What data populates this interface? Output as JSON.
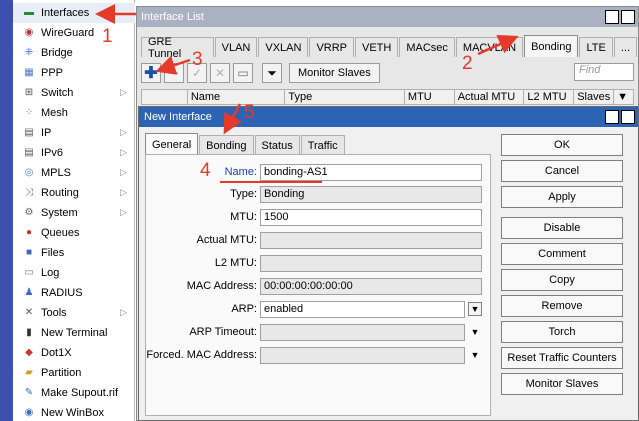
{
  "sidebar": {
    "items": [
      {
        "label": "Interfaces",
        "icon": "interfaces-icon",
        "glyph": "▬",
        "color": "#2a8a3a",
        "chev": false
      },
      {
        "label": "WireGuard",
        "icon": "wireguard-icon",
        "glyph": "◉",
        "color": "#b8323a",
        "chev": false
      },
      {
        "label": "Bridge",
        "icon": "bridge-icon",
        "glyph": "⁜",
        "color": "#2f6bbf",
        "chev": false
      },
      {
        "label": "PPP",
        "icon": "ppp-icon",
        "glyph": "▦",
        "color": "#4a7ac8",
        "chev": false
      },
      {
        "label": "Switch",
        "icon": "switch-icon",
        "glyph": "⊞",
        "color": "#555555",
        "chev": true
      },
      {
        "label": "Mesh",
        "icon": "mesh-icon",
        "glyph": "⁘",
        "color": "#3a6bbf",
        "chev": false
      },
      {
        "label": "IP",
        "icon": "ip-icon",
        "glyph": "▤",
        "color": "#555555",
        "chev": true
      },
      {
        "label": "IPv6",
        "icon": "ipv6-icon",
        "glyph": "▤",
        "color": "#555555",
        "chev": true
      },
      {
        "label": "MPLS",
        "icon": "mpls-icon",
        "glyph": "◎",
        "color": "#4a7ac8",
        "chev": true
      },
      {
        "label": "Routing",
        "icon": "routing-icon",
        "glyph": "⤨",
        "color": "#3a8a4a",
        "chev": true
      },
      {
        "label": "System",
        "icon": "system-icon",
        "glyph": "⚙",
        "color": "#6a6a6a",
        "chev": true
      },
      {
        "label": "Queues",
        "icon": "queues-icon",
        "glyph": "●",
        "color": "#c0392b",
        "chev": false
      },
      {
        "label": "Files",
        "icon": "files-icon",
        "glyph": "■",
        "color": "#3a6bbf",
        "chev": false
      },
      {
        "label": "Log",
        "icon": "log-icon",
        "glyph": "▭",
        "color": "#777777",
        "chev": false
      },
      {
        "label": "RADIUS",
        "icon": "radius-icon",
        "glyph": "♟",
        "color": "#3a6bbf",
        "chev": false
      },
      {
        "label": "Tools",
        "icon": "tools-icon",
        "glyph": "✕",
        "color": "#555555",
        "chev": true
      },
      {
        "label": "New Terminal",
        "icon": "terminal-icon",
        "glyph": "▮",
        "color": "#333333",
        "chev": false
      },
      {
        "label": "Dot1X",
        "icon": "dot1x-icon",
        "glyph": "◆",
        "color": "#c0392b",
        "chev": false
      },
      {
        "label": "Partition",
        "icon": "partition-icon",
        "glyph": "▰",
        "color": "#d69a2a",
        "chev": false
      },
      {
        "label": "Make Supout.rif",
        "icon": "supout-icon",
        "glyph": "✎",
        "color": "#3a6bbf",
        "chev": false
      },
      {
        "label": "New WinBox",
        "icon": "winbox-icon",
        "glyph": "◉",
        "color": "#3a6bbf",
        "chev": false
      }
    ]
  },
  "iface_window": {
    "title": "Interface List",
    "tabs": [
      "GRE Tunnel",
      "VLAN",
      "VXLAN",
      "VRRP",
      "VETH",
      "MACsec",
      "MACVLAN",
      "Bonding",
      "LTE",
      "..."
    ],
    "active_tab": "Bonding",
    "monitor_slaves": "Monitor Slaves",
    "find_placeholder": "Find",
    "columns": [
      "",
      "Name",
      "Type",
      "MTU",
      "Actual MTU",
      "L2 MTU",
      "Slaves"
    ]
  },
  "dialog": {
    "title": "New Interface",
    "tabs": [
      "General",
      "Bonding",
      "Status",
      "Traffic"
    ],
    "active_tab": "General",
    "fields": {
      "name_label": "Name:",
      "name_value": "bonding-AS1",
      "type_label": "Type:",
      "type_value": "Bonding",
      "mtu_label": "MTU:",
      "mtu_value": "1500",
      "actual_mtu_label": "Actual MTU:",
      "actual_mtu_value": "",
      "l2_mtu_label": "L2 MTU:",
      "l2_mtu_value": "",
      "mac_label": "MAC Address:",
      "mac_value": "00:00:00:00:00:00",
      "arp_label": "ARP:",
      "arp_value": "enabled",
      "arp_timeout_label": "ARP Timeout:",
      "arp_timeout_value": "",
      "forced_mac_label": "Forced. MAC Address:",
      "forced_mac_value": ""
    },
    "buttons": [
      "OK",
      "Cancel",
      "Apply",
      "Disable",
      "Comment",
      "Copy",
      "Remove",
      "Torch",
      "Reset Traffic Counters",
      "Monitor Slaves"
    ]
  },
  "annotations": {
    "n1": "1",
    "n2": "2",
    "n3": "3",
    "n4": "4",
    "n5": "5",
    "color": "#e53a2a"
  }
}
